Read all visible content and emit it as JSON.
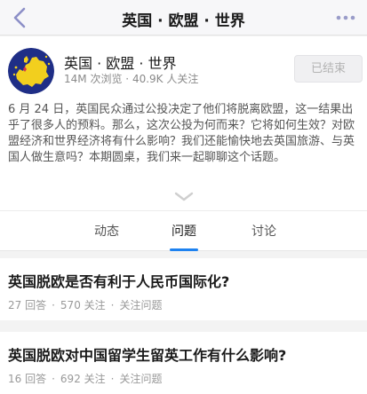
{
  "nav": {
    "back_icon": "chevron-left-icon",
    "title": "英国 · 欧盟 · 世界",
    "more_icon": "ellipsis-icon"
  },
  "topic": {
    "avatar_icon": "eu-map-icon",
    "title": "英国 · 欧盟 · 世界",
    "views": "14M 次浏览",
    "separator": "·",
    "followers": "40.9K 人关注",
    "status_button": "已结束",
    "description": "6 月 24 日，英国民众通过公投决定了他们将脱离欧盟，这一结果出乎了很多人的预料。那么，这次公投为何而来？它将如何生效？对欧盟经济和世界经济将有什么影响？我们还能愉快地去英国旅游、与英国人做生意吗？本期圆桌，我们来一起聊聊这个话题。",
    "expand_icon": "chevron-down-icon"
  },
  "tabs": [
    {
      "label": "动态",
      "active": false
    },
    {
      "label": "问题",
      "active": true
    },
    {
      "label": "讨论",
      "active": false
    }
  ],
  "questions": [
    {
      "title": "英国脱欧是否有利于人民币国际化?",
      "answers": "27 回答",
      "follows": "570 关注",
      "follow_action": "关注问题"
    },
    {
      "title": "英国脱欧对中国留学生留英工作有什么影响?",
      "answers": "16 回答",
      "follows": "692 关注",
      "follow_action": "关注问题"
    }
  ],
  "colors": {
    "accent": "#1e82f0",
    "nav_icon": "#8c8fc7",
    "avatar_bg": "#1f2e86",
    "avatar_map": "#f2cf1e"
  }
}
